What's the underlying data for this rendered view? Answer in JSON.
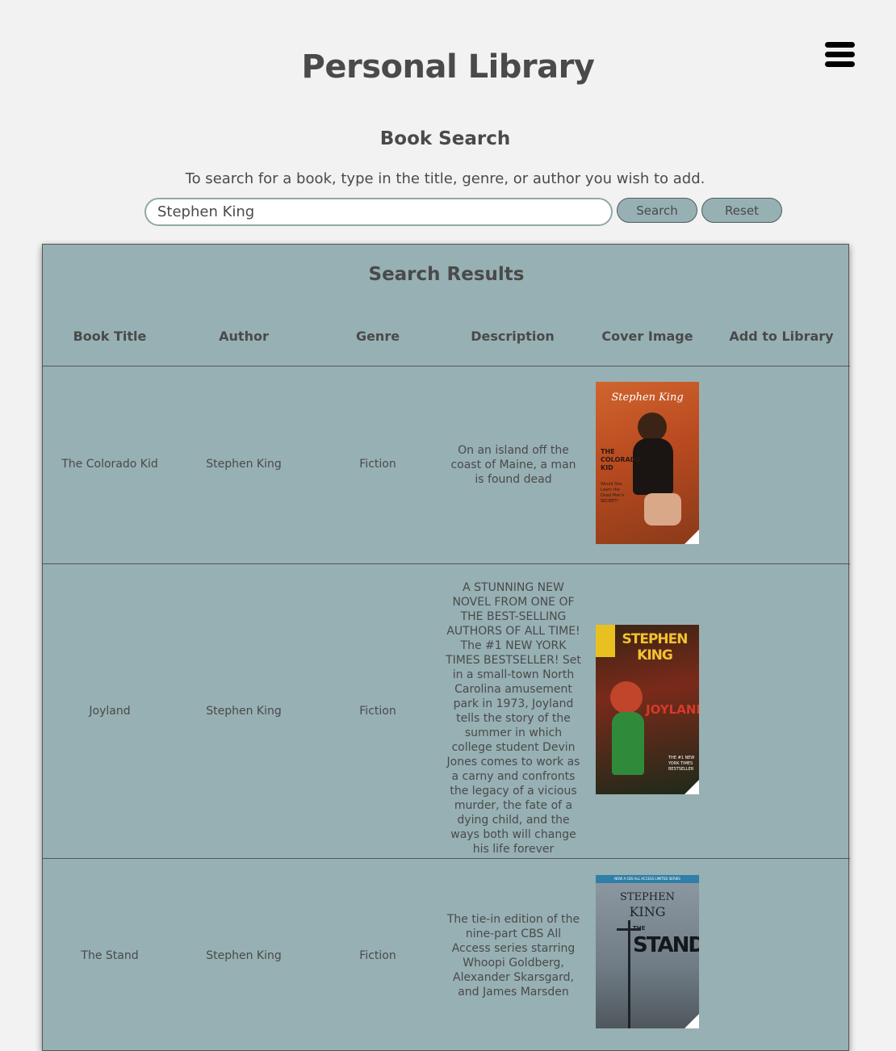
{
  "header": {
    "title": "Personal Library",
    "menu_icon": "hamburger-menu-icon"
  },
  "search": {
    "heading": "Book Search",
    "instructions": "To search for a book, type in the title, genre, or author you wish to add.",
    "value": "Stephen King",
    "search_label": "Search",
    "reset_label": "Reset"
  },
  "results": {
    "title": "Search Results",
    "columns": [
      "Book Title",
      "Author",
      "Genre",
      "Description",
      "Cover Image",
      "Add to Library"
    ],
    "rows": [
      {
        "title": "The Colorado Kid",
        "author": "Stephen King",
        "genre": "Fiction",
        "description": "On an island off the coast of Maine, a man is found dead",
        "cover": {
          "author": "Stephen King",
          "title": "THE COLORADO KID",
          "tagline": "Would She Learn the Dead Man's SECRET?"
        }
      },
      {
        "title": "Joyland",
        "author": "Stephen King",
        "genre": "Fiction",
        "description": "A STUNNING NEW NOVEL FROM ONE OF THE BEST-SELLING AUTHORS OF ALL TIME! The #1 NEW YORK TIMES BESTSELLER! Set in a small-town North Carolina amusement park in 1973, Joyland tells the story of the summer in which college student Devin Jones comes to work as a carny and confronts the legacy of a vicious murder, the fate of a dying child, and the ways both will change his life forever",
        "cover": {
          "author": "STEPHEN KING",
          "title": "JOYLAND",
          "badge": "THE #1 NEW YORK TIMES BESTSELLER"
        }
      },
      {
        "title": "The Stand",
        "author": "Stephen King",
        "genre": "Fiction",
        "description": "The tie-in edition of the nine-part CBS All Access series starring Whoopi Goldberg, Alexander Skarsgard, and James Marsden",
        "cover": {
          "banner": "NOW A CBS ALL ACCESS LIMITED SERIES",
          "author_first": "STEPHEN",
          "author_last": "KING",
          "title_small": "THE",
          "title": "STAND"
        }
      }
    ]
  },
  "colors": {
    "background": "#f2f2f2",
    "panel": "#97b0b3",
    "text": "#4a4a4a"
  }
}
